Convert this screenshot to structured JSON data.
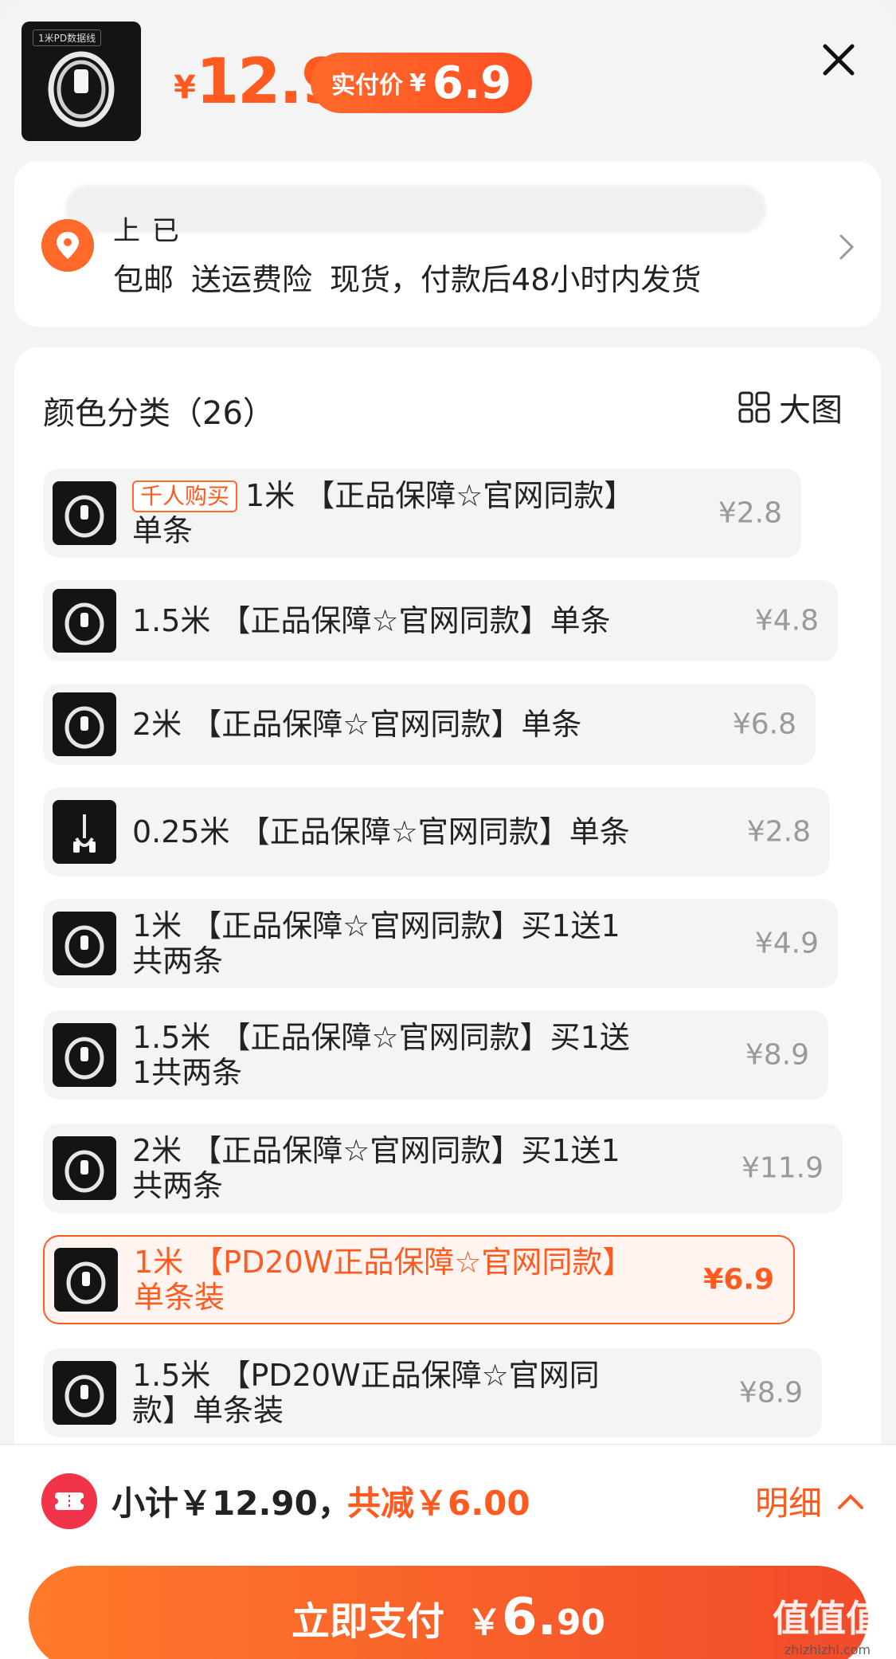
{
  "header": {
    "product_tag": "1米PD数据线",
    "price_symbol": "¥",
    "price": "12.9",
    "paid_label": "实付价",
    "paid_symbol": "¥",
    "paid_value": "6.9",
    "close_icon": "close-icon"
  },
  "address": {
    "partial_text": "上 已",
    "shipping": [
      "包邮",
      "送运费险",
      "现货，付款后48小时内发货"
    ]
  },
  "sku_list": {
    "title": "颜色分类（26）",
    "big_image_label": "大图",
    "items": [
      {
        "badge": "千人购买",
        "name": "1米 【正品保障☆官网同款】单条",
        "price": "¥2.8",
        "selected": false
      },
      {
        "badge": "",
        "name": "1.5米 【正品保障☆官网同款】单条",
        "price": "¥4.8",
        "selected": false
      },
      {
        "badge": "",
        "name": "2米 【正品保障☆官网同款】单条",
        "price": "¥6.8",
        "selected": false
      },
      {
        "badge": "",
        "name": "0.25米 【正品保障☆官网同款】单条",
        "price": "¥2.8",
        "selected": false
      },
      {
        "badge": "",
        "name": "1米 【正品保障☆官网同款】买1送1共两条",
        "price": "¥4.9",
        "selected": false
      },
      {
        "badge": "",
        "name": "1.5米 【正品保障☆官网同款】买1送1共两条",
        "price": "¥8.9",
        "selected": false
      },
      {
        "badge": "",
        "name": "2米 【正品保障☆官网同款】买1送1共两条",
        "price": "¥11.9",
        "selected": false
      },
      {
        "badge": "",
        "name": "1米 【PD20W正品保障☆官网同款】单条装",
        "price": "¥6.9",
        "selected": true
      },
      {
        "badge": "",
        "name": "1.5米 【PD20W正品保障☆官网同款】单条装",
        "price": "¥8.9",
        "selected": false
      }
    ]
  },
  "bottom": {
    "subtotal": "小计￥12.90，",
    "discount": "共减￥6.00",
    "detail": "明细",
    "pay_label": "立即支付",
    "pay_symbol": "￥",
    "pay_big": "6.",
    "pay_cents": "90"
  },
  "watermark": {
    "text": "值值值",
    "url": "zhizhizhi.com"
  },
  "colors": {
    "accent": "#ff5a1f",
    "coupon": "#f2344a"
  }
}
